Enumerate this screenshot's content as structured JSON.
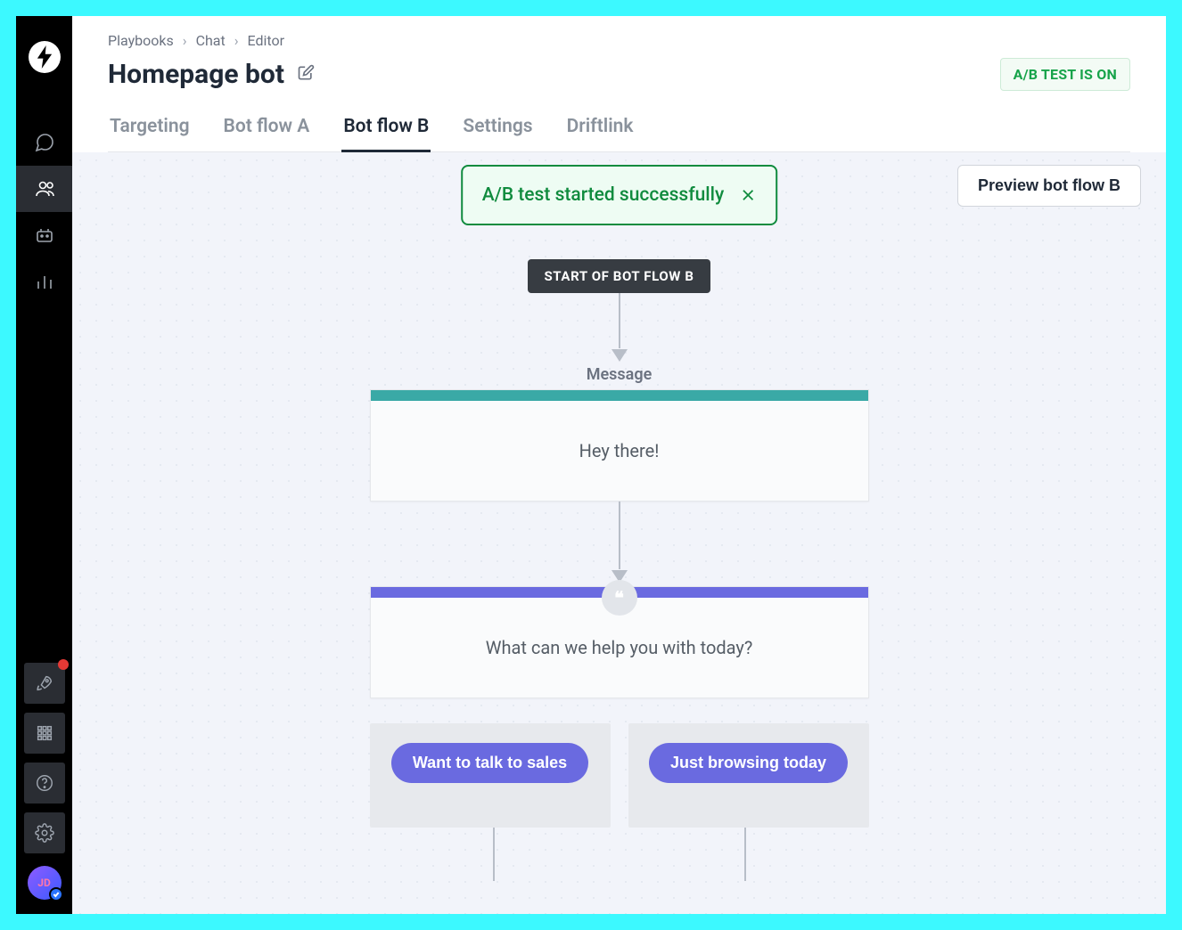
{
  "breadcrumbs": [
    "Playbooks",
    "Chat",
    "Editor"
  ],
  "page_title": "Homepage bot",
  "ab_badge": "A/B TEST IS ON",
  "tabs": [
    {
      "label": "Targeting",
      "active": false
    },
    {
      "label": "Bot flow A",
      "active": false
    },
    {
      "label": "Bot flow B",
      "active": true
    },
    {
      "label": "Settings",
      "active": false
    },
    {
      "label": "Driftlink",
      "active": false
    }
  ],
  "toast": {
    "text": "A/B test started successfully"
  },
  "preview_button": "Preview bot flow B",
  "flow": {
    "start_label": "START OF BOT FLOW B",
    "message_label": "Message",
    "message_text": "Hey there!",
    "question_text": "What can we help you with today?",
    "choices": [
      {
        "label": "Want to talk to sales"
      },
      {
        "label": "Just browsing today"
      }
    ]
  },
  "avatar_initials": "JD",
  "sidebar": {
    "icons": [
      "chat",
      "contacts",
      "bot",
      "analytics"
    ],
    "bottom": [
      "rocket",
      "apps",
      "help",
      "settings"
    ]
  }
}
